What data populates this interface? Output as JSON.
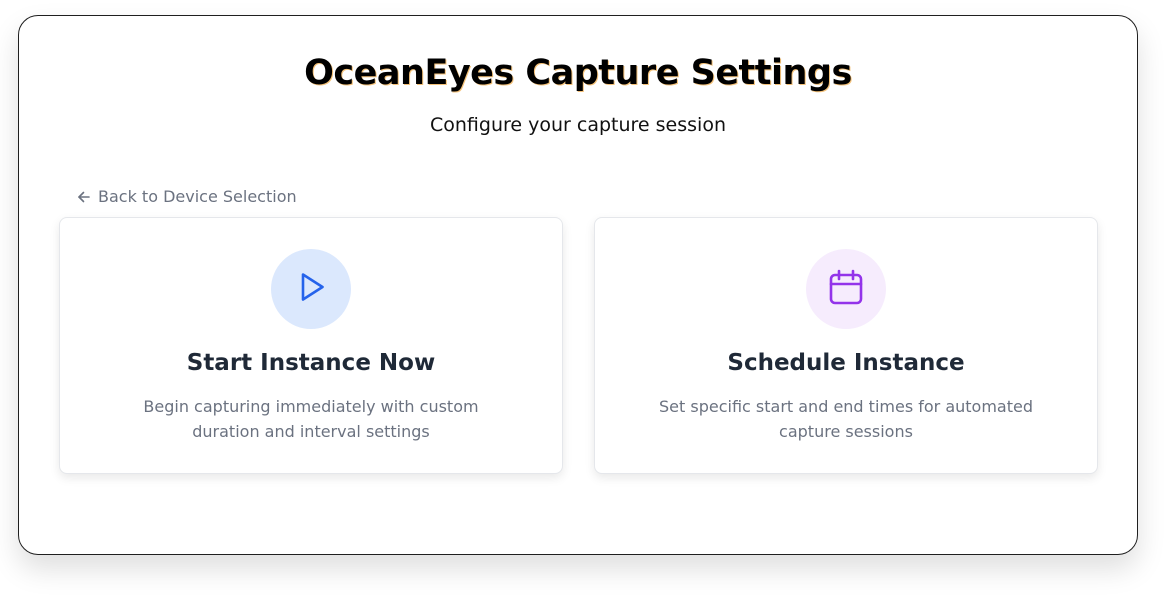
{
  "header": {
    "title": "OceanEyes Capture Settings",
    "subtitle": "Configure your capture session"
  },
  "navigation": {
    "back_label": "Back to Device Selection",
    "back_icon": "arrow-left-icon"
  },
  "options": [
    {
      "title": "Start Instance Now",
      "description": "Begin capturing immediately with custom duration and interval settings",
      "icon": "play-icon",
      "icon_color": "#2563eb",
      "icon_bg": "#dbe8fd"
    },
    {
      "title": "Schedule Instance",
      "description": "Set specific start and end times for automated capture sessions",
      "icon": "calendar-icon",
      "icon_color": "#9333ea",
      "icon_bg": "#f6ecfd"
    }
  ],
  "colors": {
    "text_primary": "#1f2937",
    "text_muted": "#6b7280",
    "card_border": "#e5e7eb",
    "panel_border": "#1f1f1f"
  }
}
